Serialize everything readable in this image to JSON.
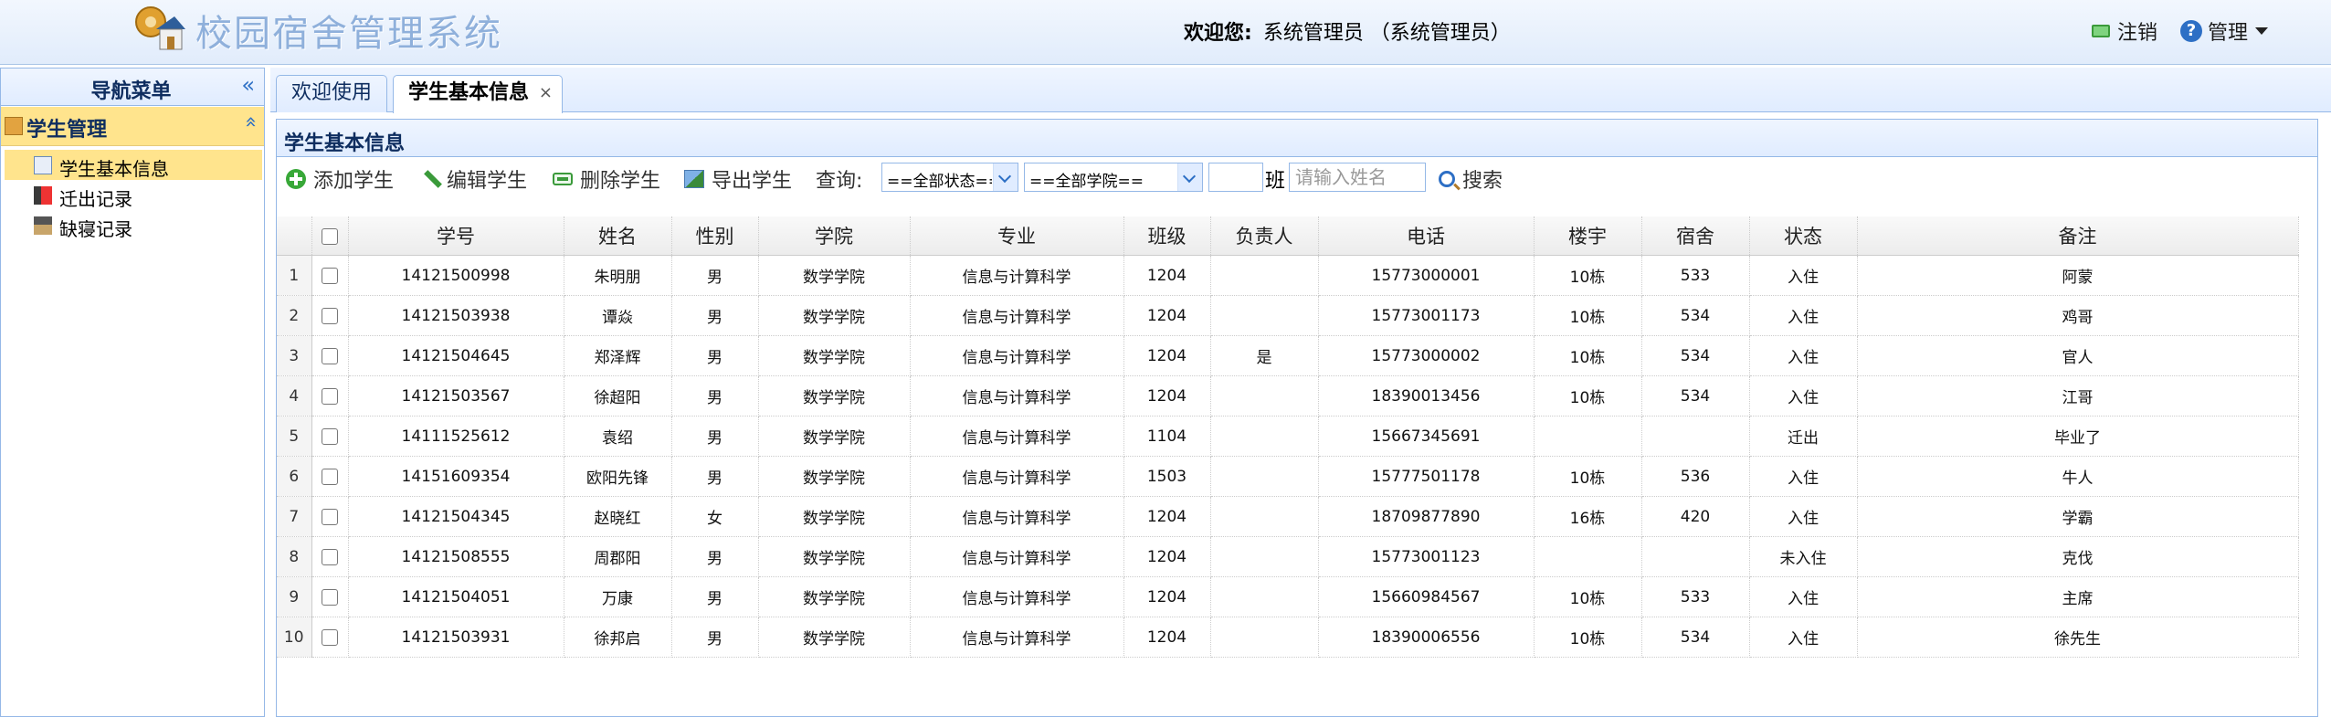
{
  "header": {
    "title": "校园宿舍管理系统",
    "welcome_label": "欢迎您:",
    "user": "系统管理员 （系统管理员）",
    "logout": "注销",
    "admin": "管理"
  },
  "sidebar": {
    "title": "导航菜单",
    "collapse_icon": "«",
    "group": {
      "title": "学生管理",
      "collapse_icon": "«",
      "items": [
        {
          "label": "学生基本信息",
          "icon": "info-icon"
        },
        {
          "label": "迁出记录",
          "icon": "move-out-icon"
        },
        {
          "label": "缺寝记录",
          "icon": "absence-icon"
        }
      ]
    }
  },
  "tabs": [
    {
      "label": "欢迎使用"
    },
    {
      "label": "学生基本信息",
      "close": "×"
    }
  ],
  "panel": {
    "title": "学生基本信息",
    "toolbar": {
      "add": "添加学生",
      "edit": "编辑学生",
      "delete": "删除学生",
      "export": "导出学生",
      "query": "查询:",
      "status_value": "==全部状态==",
      "college_value": "==全部学院==",
      "class_label": "班",
      "name_placeholder": "请输入姓名",
      "search": "搜索"
    },
    "columns": [
      "学号",
      "姓名",
      "性别",
      "学院",
      "专业",
      "班级",
      "负责人",
      "电话",
      "楼宇",
      "宿舍",
      "状态",
      "备注"
    ],
    "rows": [
      {
        "n": "1",
        "id": "14121500998",
        "name": "朱明朋",
        "gender": "男",
        "college": "数学学院",
        "major": "信息与计算科学",
        "cls": "1204",
        "leader": "",
        "phone": "15773000001",
        "building": "10栋",
        "room": "533",
        "status": "入住",
        "remark": "阿蒙"
      },
      {
        "n": "2",
        "id": "14121503938",
        "name": "谭焱",
        "gender": "男",
        "college": "数学学院",
        "major": "信息与计算科学",
        "cls": "1204",
        "leader": "",
        "phone": "15773001173",
        "building": "10栋",
        "room": "534",
        "status": "入住",
        "remark": "鸡哥"
      },
      {
        "n": "3",
        "id": "14121504645",
        "name": "郑泽辉",
        "gender": "男",
        "college": "数学学院",
        "major": "信息与计算科学",
        "cls": "1204",
        "leader": "是",
        "phone": "15773000002",
        "building": "10栋",
        "room": "534",
        "status": "入住",
        "remark": "官人"
      },
      {
        "n": "4",
        "id": "14121503567",
        "name": "徐超阳",
        "gender": "男",
        "college": "数学学院",
        "major": "信息与计算科学",
        "cls": "1204",
        "leader": "",
        "phone": "18390013456",
        "building": "10栋",
        "room": "534",
        "status": "入住",
        "remark": "江哥"
      },
      {
        "n": "5",
        "id": "14111525612",
        "name": "袁绍",
        "gender": "男",
        "college": "数学学院",
        "major": "信息与计算科学",
        "cls": "1104",
        "leader": "",
        "phone": "15667345691",
        "building": "",
        "room": "",
        "status": "迁出",
        "remark": "毕业了"
      },
      {
        "n": "6",
        "id": "14151609354",
        "name": "欧阳先锋",
        "gender": "男",
        "college": "数学学院",
        "major": "信息与计算科学",
        "cls": "1503",
        "leader": "",
        "phone": "15777501178",
        "building": "10栋",
        "room": "536",
        "status": "入住",
        "remark": "牛人"
      },
      {
        "n": "7",
        "id": "14121504345",
        "name": "赵晓红",
        "gender": "女",
        "college": "数学学院",
        "major": "信息与计算科学",
        "cls": "1204",
        "leader": "",
        "phone": "18709877890",
        "building": "16栋",
        "room": "420",
        "status": "入住",
        "remark": "学霸"
      },
      {
        "n": "8",
        "id": "14121508555",
        "name": "周郡阳",
        "gender": "男",
        "college": "数学学院",
        "major": "信息与计算科学",
        "cls": "1204",
        "leader": "",
        "phone": "15773001123",
        "building": "",
        "room": "",
        "status": "未入住",
        "remark": "克伐"
      },
      {
        "n": "9",
        "id": "14121504051",
        "name": "万康",
        "gender": "男",
        "college": "数学学院",
        "major": "信息与计算科学",
        "cls": "1204",
        "leader": "",
        "phone": "15660984567",
        "building": "10栋",
        "room": "533",
        "status": "入住",
        "remark": "主席"
      },
      {
        "n": "10",
        "id": "14121503931",
        "name": "徐邦启",
        "gender": "男",
        "college": "数学学院",
        "major": "信息与计算科学",
        "cls": "1204",
        "leader": "",
        "phone": "18390006556",
        "building": "10栋",
        "room": "534",
        "status": "入住",
        "remark": "徐先生"
      }
    ]
  }
}
